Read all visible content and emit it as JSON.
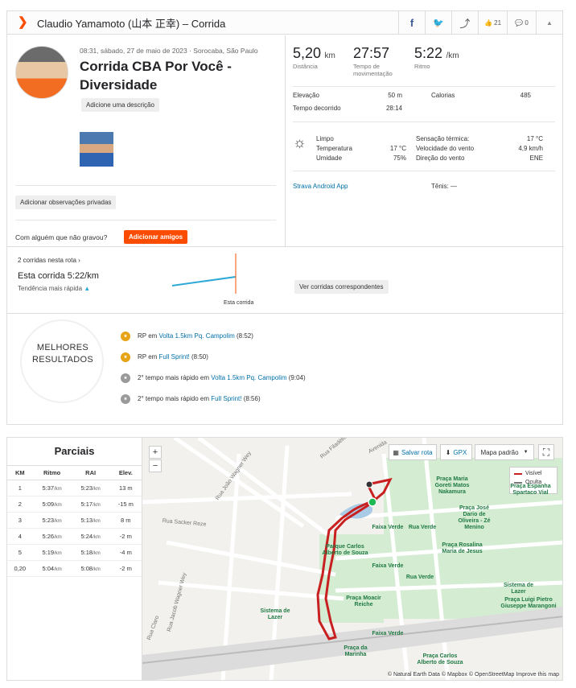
{
  "header": {
    "title": "Claudio Yamamoto (山本 正幸) – Corrida",
    "facebook": "f",
    "twitter": "🐦",
    "share": "⤴",
    "kudos": "👍 21",
    "comments": "💬 0",
    "collapse": "▲"
  },
  "activity": {
    "meta": "08:31, sábado, 27 de maio de 2023 · Sorocaba, São Paulo",
    "title": "Corrida CBA Por Você - Diversidade",
    "add_description": "Adicione uma descrição",
    "add_private_notes": "Adicionar observações privadas",
    "with_someone": "Com alguém que não gravou?",
    "add_friends": "Adicionar amigos"
  },
  "stats": {
    "distance": {
      "value": "5,20",
      "unit": "km",
      "label": "Distância"
    },
    "moving_time": {
      "value": "27:57",
      "unit": "",
      "label": "Tempo de movimentação"
    },
    "pace": {
      "value": "5:22",
      "unit": "/km",
      "label": "Ritmo"
    },
    "elevation_label": "Elevação",
    "elevation_value": "50 m",
    "calories_label": "Calorias",
    "calories_value": "485",
    "elapsed_label": "Tempo decorrido",
    "elapsed_value": "28:14"
  },
  "weather": {
    "condition_label": "Limpo",
    "temp_label": "Temperatura",
    "temp_value": "17 °C",
    "humidity_label": "Umidade",
    "humidity_value": "75%",
    "feels_label": "Sensação térmica:",
    "feels_value": "17 °C",
    "wind_speed_label": "Velocidade do vento",
    "wind_speed_value": "4,9 km/h",
    "wind_dir_label": "Direção do vento",
    "wind_dir_value": "ENE"
  },
  "device": {
    "app": "Strava Android App",
    "shoes": "Tênis: —"
  },
  "segment": {
    "count": "2 corridas nesta rota",
    "this_run_label": "Esta corrida",
    "this_run_value": "5:22/km",
    "trend": "Tendência mais rápida",
    "chart_label": "Esta corrida",
    "view_button": "Ver corridas correspondentes"
  },
  "best": {
    "label_line1": "MELHORES",
    "label_line2": "RESULTADOS",
    "items": [
      {
        "prefix": "RP em ",
        "link": "Volta 1.5km Pq. Campolim",
        "suffix": " (8:52)",
        "medal": "gold"
      },
      {
        "prefix": "RP em ",
        "link": "Full Sprint!",
        "suffix": " (8:50)",
        "medal": "gold"
      },
      {
        "prefix": "2° tempo mais rápido em ",
        "link": "Volta 1.5km Pq. Campolim",
        "suffix": " (9:04)",
        "medal": "silver"
      },
      {
        "prefix": "2° tempo mais rápido em ",
        "link": "Full Sprint!",
        "suffix": " (8:56)",
        "medal": "silver"
      }
    ]
  },
  "splits": {
    "title": "Parciais",
    "headers": [
      "KM",
      "Ritmo",
      "RAI",
      "Elev."
    ],
    "rows": [
      [
        "1",
        "5:37",
        "5:23",
        "13 m"
      ],
      [
        "2",
        "5:09",
        "5:17",
        "-15 m"
      ],
      [
        "3",
        "5:23",
        "5:13",
        "8 m"
      ],
      [
        "4",
        "5:26",
        "5:24",
        "-2 m"
      ],
      [
        "5",
        "5:19",
        "5:18",
        "-4 m"
      ],
      [
        "0,20",
        "5:04",
        "5:08",
        "-2 m"
      ]
    ],
    "unit": "/km"
  },
  "map": {
    "zoom_in": "+",
    "zoom_out": "−",
    "save_route": "Salvar rota",
    "gpx": "GPX",
    "map_style": "Mapa padrão",
    "legend_visible": "Visível",
    "legend_hidden": "Oculta",
    "attribution": "© Natural Earth Data © Mapbox © OpenStreetMap Improve this map",
    "places": [
      "Praça Maria Goreti Matos Nakamura",
      "Faixa Verde",
      "Rua Verde",
      "Praça José Dario de Oliveira - Zé Menino",
      "Parque Carlos Alberto de Souza",
      "Praça Rosalina Maria de Jesus",
      "Faixa Verde",
      "Rua Verde",
      "Praça Moacir Reiche",
      "Sistema de Lazer",
      "Sistema de Lazer",
      "Praça Luigi Pietro Giuseppe Marangoni",
      "Faixa Verde",
      "Praça da Marinha",
      "Praça Carlos Alberto de Souza",
      "Rua Verde",
      "Praça Espanha Spartaco Vial"
    ],
    "streets": [
      "Rua Filadélfia",
      "Rua Sacker Reze",
      "Rua João Wagner Wey",
      "Rua Jacob Wagner Wey",
      "Rua Claro",
      "Avenida"
    ]
  }
}
